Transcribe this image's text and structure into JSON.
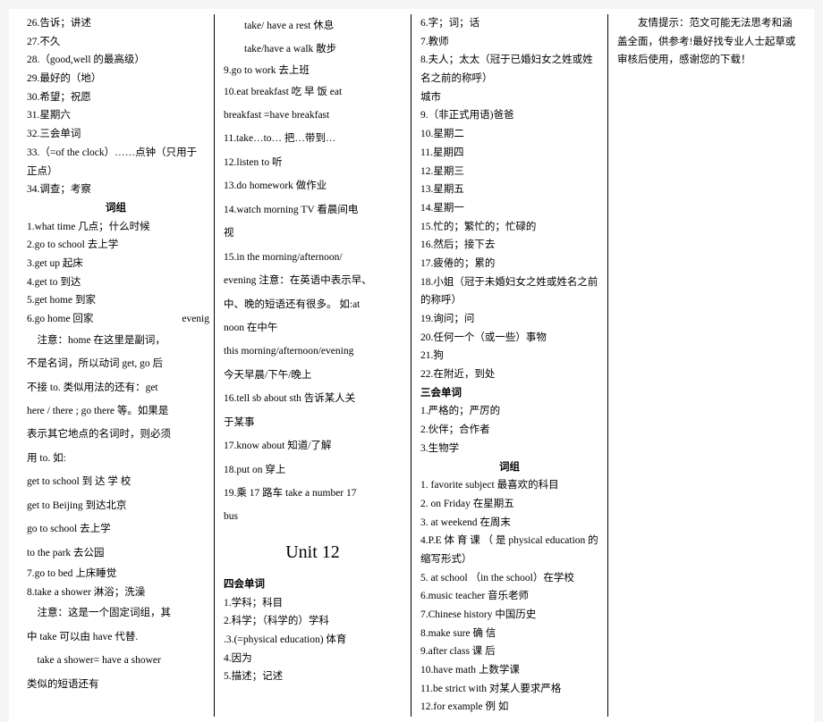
{
  "col1": {
    "items1": [
      "26.告诉；讲述",
      "27.不久",
      "28.（good,well 的最高级）",
      "29.最好的（地）",
      "30.希望；祝愿",
      "31.星期六",
      "32.三会单词",
      "33.（=of the clock）……点钟（只用于正点）",
      "34.调查；考察"
    ],
    "phrase_heading": "词组",
    "phrases1": [
      "1.what time  几点；什么时候",
      "2.go to school  去上学",
      "3.get up  起床",
      "4.get to  到达",
      "5.get home  到家",
      "6.go home  回家"
    ],
    "evenig": "evenig",
    "note1a": "注意：home 在这里是副词，",
    "note1b": "不是名词，所以动词 get, go 后",
    "note1c": "不接 to. 类似用法的还有：get",
    "note1d": "here / there ; go there  等。如果是",
    "note1e": "表示其它地点的名词时，则必须",
    "note1f": "用 to.  如:",
    "ex1": "get  to  school          到 达 学 校",
    "ex2": "get to Beijing      到达北京",
    "ex3": "go to school        去上学",
    "ex4": "to the park      去公园",
    "item7": "7.go to bed  上床睡觉",
    "item8": "8.take a shower    淋浴；洗澡",
    "note2a": "注意：这是一个固定词组，其",
    "note2b": "中 take  可以由 have  代替.",
    "note2c": "take a shower= have a shower",
    "note2d": "类似的短语还有"
  },
  "col2": {
    "rest1": "take/ have a rest      休息",
    "rest2": "take/have a walk      散步",
    "items": [
      "9.go to work  去上班",
      "10.eat  breakfast   吃 早 饭     eat",
      "breakfast =have breakfast",
      "11.take…to…   把…带到…",
      "12.listen to  听",
      "13.do homework  做作业",
      "14.watch morning TV 看晨间电",
      "视",
      "15.in the morning/afternoon/"
    ],
    "evening_note": "evening 注意：在英语中表示早、",
    "evening_note2": "中、晚的短语还有很多。 如:at",
    "evening_note3": "noon  在中午",
    "evening_note4": "this    morning/afternoon/evening",
    "evening_note5": "今天早晨/下午/晚上",
    "item16": "16.tell sb about sth    告诉某人关",
    "item16b": "于某事",
    "item17": "17.know about 知道/了解",
    "item18": "18.put on  穿上",
    "item19": "19.乘 17 路车 take a number 17",
    "item19b": "bus",
    "unit_title": "Unit 12",
    "four_heading": "四会单词",
    "four_items": [
      "1.学科；科目",
      "2.科学；（科学的）学科",
      ".3.(=physical education) 体育",
      "4.因为",
      "5.描述；记述"
    ]
  },
  "col3": {
    "items1": [
      "6.字；词；话",
      "7.教师",
      "8.夫人；太太（冠于已婚妇女之姓或姓名之前的称呼）",
      "城市",
      "9.（非正式用语)爸爸",
      "10.星期二",
      "11.星期四",
      "12.星期三",
      "13.星期五",
      "14.星期一",
      "15.忙的；繁忙的；忙碌的",
      "16.然后；接下去",
      "17.疲倦的；累的",
      "18.小姐（冠于未婚妇女之姓或姓名之前的称呼）",
      "19.询问；问",
      "20.任何一个（或一些）事物",
      "21.狗",
      "22.在附近，到处"
    ],
    "three_heading": "三会单词",
    "three_items": [
      "1.严格的；严厉的",
      "2.伙伴；合作者",
      "3.生物学"
    ],
    "phrase_heading": "词组",
    "phrases": [
      "1. favorite subject 最喜欢的科目",
      "2. on Friday          在星期五",
      "3. at weekend        在周末",
      "4.P.E      体 育 课 （ 是   physical education 的缩写形式）",
      "5. at school  （in the school）在学校",
      "6.music teacher          音乐老师",
      "7.Chinese history      中国历史",
      "8.make    sure              确 信",
      "9.after    class          课 后",
      "10.have    math          上数学课",
      "11.be strict with 对某人要求严格",
      "12.for     example          例 如"
    ]
  },
  "col4": {
    "tip": "友情提示：范文可能无法思考和涵盖全面，供参考!最好找专业人士起草或审核后使用，感谢您的下载！"
  }
}
